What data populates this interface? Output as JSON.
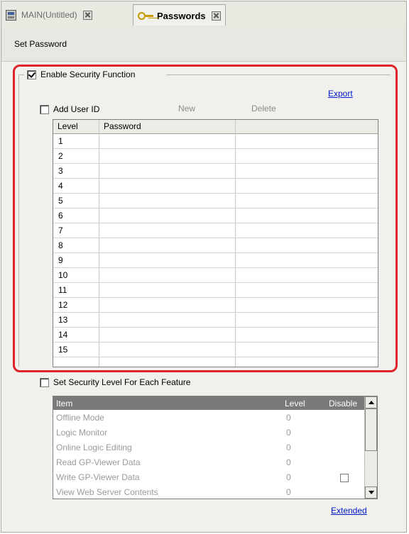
{
  "tabs": [
    {
      "label": "MAIN(Untitled)",
      "icon": "screen-icon",
      "active": false
    },
    {
      "label": "Passwords",
      "icon": "key-icon",
      "active": true
    }
  ],
  "header": {
    "title": "Set Password"
  },
  "security": {
    "enable_label": "Enable Security Function",
    "enabled": true,
    "export_label": "Export",
    "add_user_label": "Add User ID",
    "add_user_checked": false,
    "new_label": "New",
    "delete_label": "Delete",
    "table": {
      "columns": [
        "Level",
        "Password",
        ""
      ],
      "rows": [
        {
          "level": "1",
          "password": ""
        },
        {
          "level": "2",
          "password": ""
        },
        {
          "level": "3",
          "password": ""
        },
        {
          "level": "4",
          "password": ""
        },
        {
          "level": "5",
          "password": ""
        },
        {
          "level": "6",
          "password": ""
        },
        {
          "level": "7",
          "password": ""
        },
        {
          "level": "8",
          "password": ""
        },
        {
          "level": "9",
          "password": ""
        },
        {
          "level": "10",
          "password": ""
        },
        {
          "level": "11",
          "password": ""
        },
        {
          "level": "12",
          "password": ""
        },
        {
          "level": "13",
          "password": ""
        },
        {
          "level": "14",
          "password": ""
        },
        {
          "level": "15",
          "password": ""
        }
      ]
    }
  },
  "feature": {
    "label": "Set Security Level For Each Feature",
    "checked": false,
    "columns": [
      "Item",
      "Level",
      "Disable"
    ],
    "rows": [
      {
        "item": "Offline Mode",
        "level": "0",
        "disable_box": false
      },
      {
        "item": "Logic Monitor",
        "level": "0",
        "disable_box": false
      },
      {
        "item": "Online Logic Editing",
        "level": "0",
        "disable_box": false
      },
      {
        "item": "Read GP-Viewer Data",
        "level": "0",
        "disable_box": false
      },
      {
        "item": "Write GP-Viewer Data",
        "level": "0",
        "disable_box": true
      },
      {
        "item": "View Web Server Contents",
        "level": "0",
        "disable_box": false
      }
    ],
    "extended_label": "Extended"
  },
  "colors": {
    "highlight": "#e0242c",
    "link": "#0018c8"
  }
}
